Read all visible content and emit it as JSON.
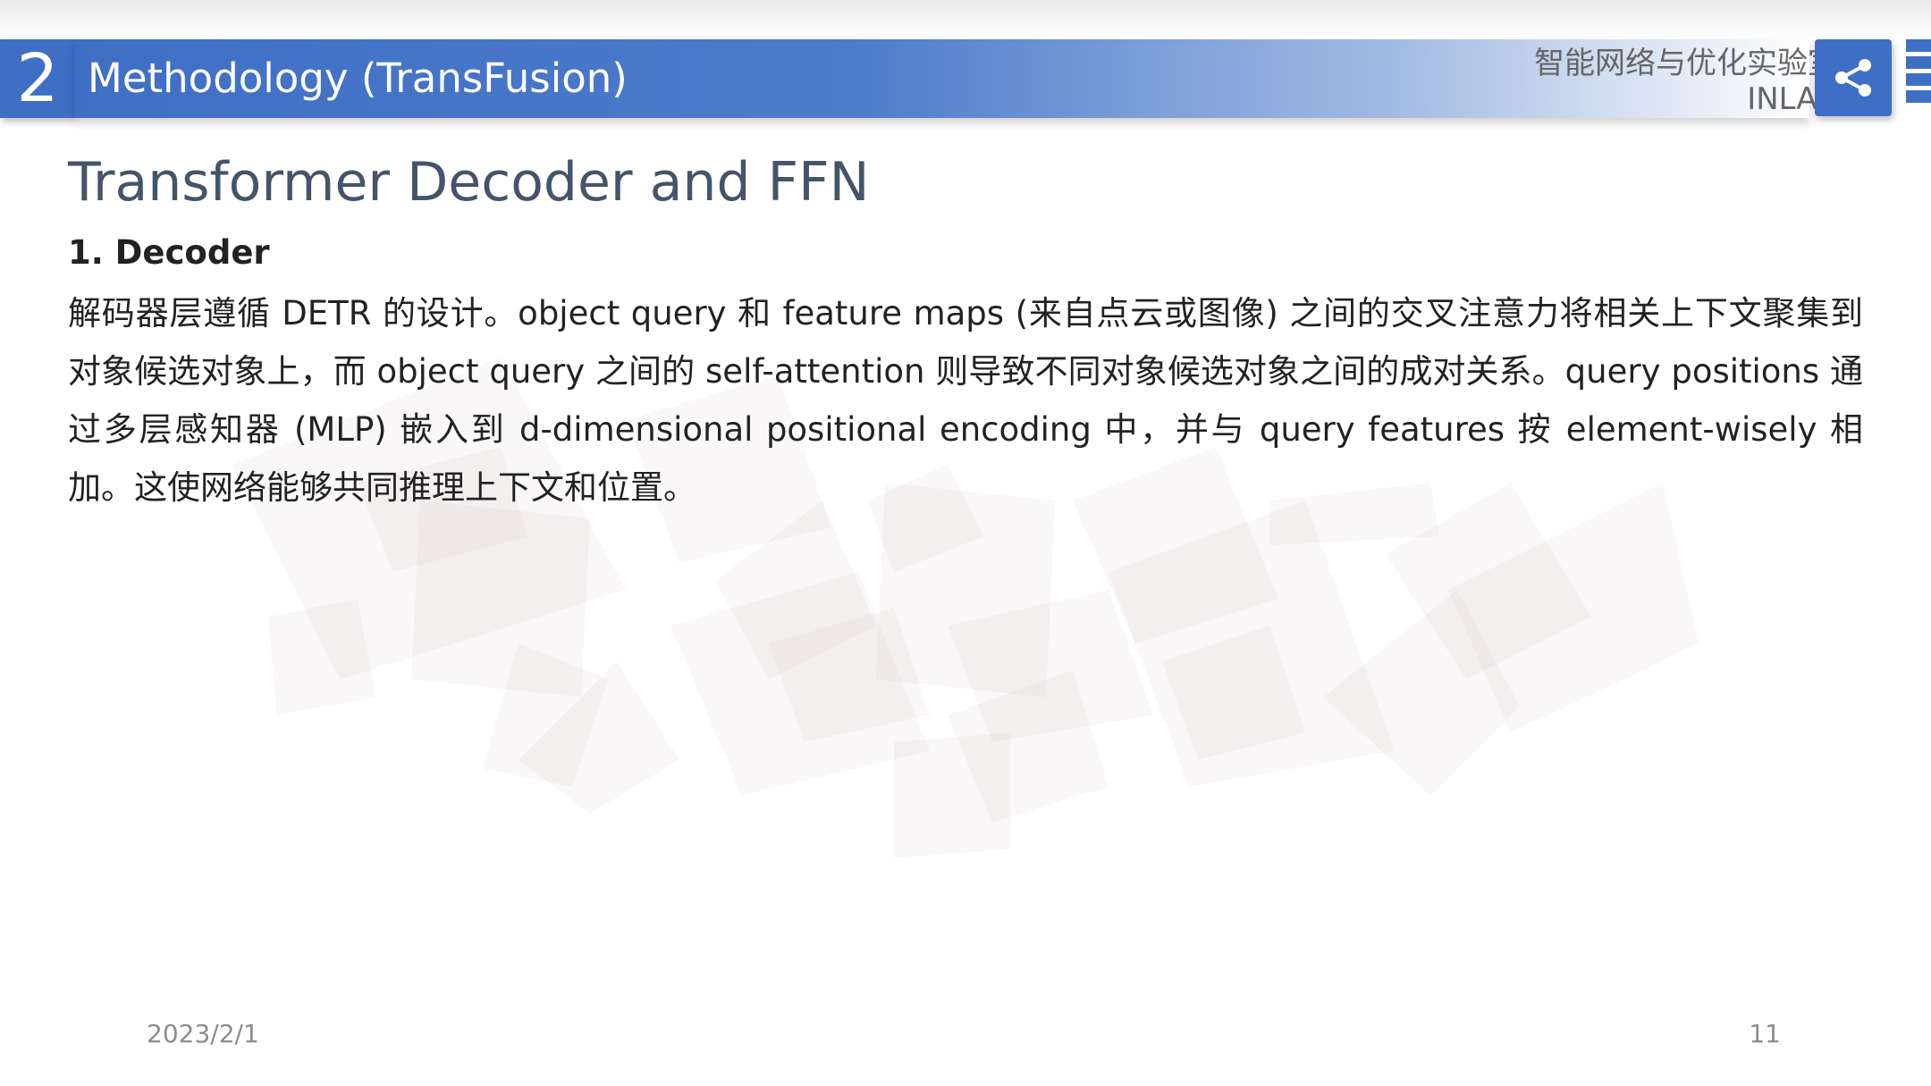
{
  "header": {
    "section_number": "2",
    "title": "Methodology (TransFusion)",
    "lab_name_cn": "智能网络与优化实验室",
    "lab_name_en": "INLAB",
    "share_icon": "share-icon",
    "accent_color": "#3f6fc4"
  },
  "slide": {
    "title": "Transformer Decoder and FFN",
    "subheading": "1. Decoder",
    "body": "解码器层遵循 DETR 的设计。object query 和 feature maps (来自点云或图像) 之间的交叉注意力将相关上下文聚集到对象候选对象上，而 object query 之间的 self-attention 则导致不同对象候选对象之间的成对关系。query positions 通过多层感知器 (MLP) 嵌入到 d-dimensional positional encoding 中，并与 query features 按 element-wisely 相加。这使网络能够共同推理上下文和位置。"
  },
  "footer": {
    "date": "2023/2/1",
    "page_number": "11"
  }
}
